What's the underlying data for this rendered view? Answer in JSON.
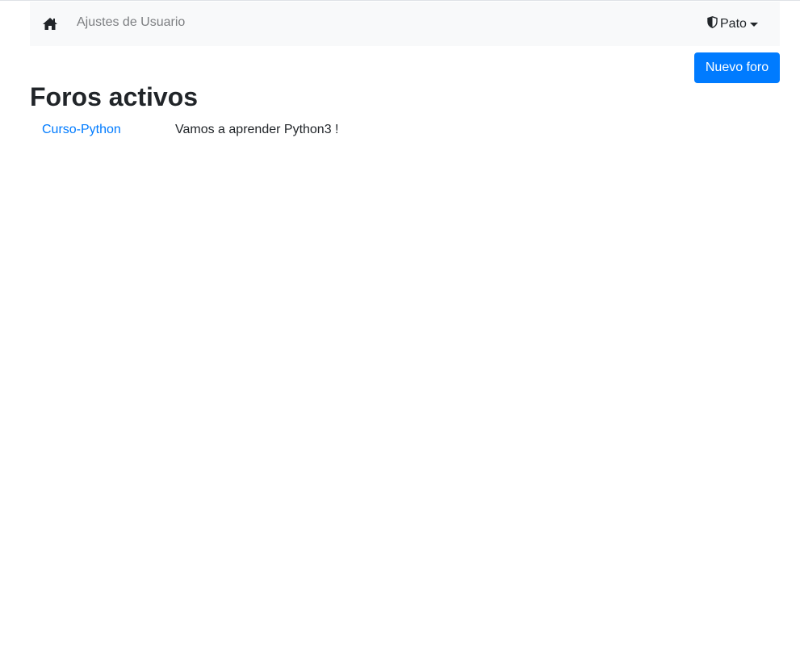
{
  "navbar": {
    "home_icon": "home-icon",
    "settings_link": "Ajustes de Usuario",
    "user_name": "Pato",
    "user_icon": "shield-icon"
  },
  "actions": {
    "new_forum_label": "Nuevo foro"
  },
  "page_title": "Foros activos",
  "forums": [
    {
      "name": "Curso-Python",
      "description": "Vamos a aprender Python3 !"
    }
  ],
  "colors": {
    "primary": "#007bff",
    "navbar_bg": "#f8f9fa",
    "text": "#212529",
    "muted_link": "#7d7f82"
  }
}
